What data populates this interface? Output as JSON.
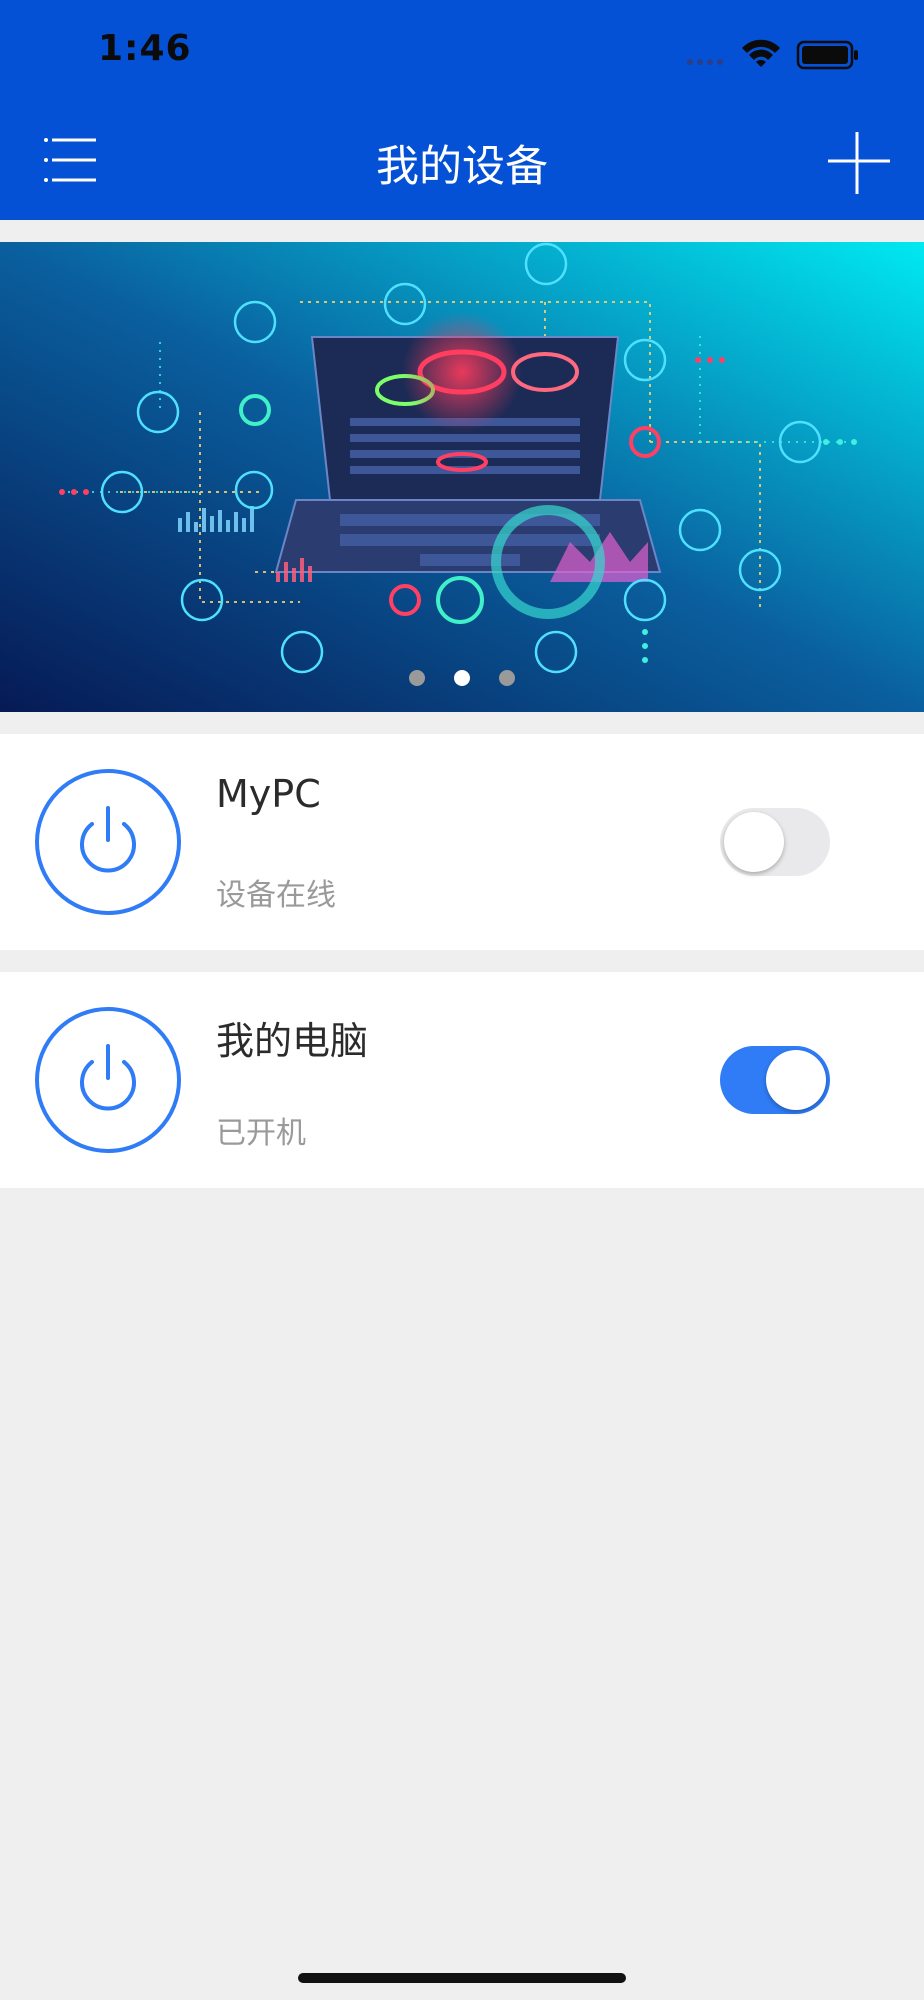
{
  "status_bar": {
    "time": "1:46"
  },
  "header": {
    "title": "我的设备",
    "menu_icon": "hamburger-menu-icon",
    "add_icon": "plus-icon"
  },
  "banner": {
    "illustration": "laptop-network-technology",
    "dots": 3,
    "active_index": 1
  },
  "devices": [
    {
      "name": "MyPC",
      "status": "设备在线",
      "toggle_on": false
    },
    {
      "name": "我的电脑",
      "status": "已开机",
      "toggle_on": true
    }
  ],
  "colors": {
    "header_bg": "#0551d6",
    "accent": "#2f7cf6",
    "page_bg": "#efefef",
    "toggle_off": "#e9e9eb"
  }
}
